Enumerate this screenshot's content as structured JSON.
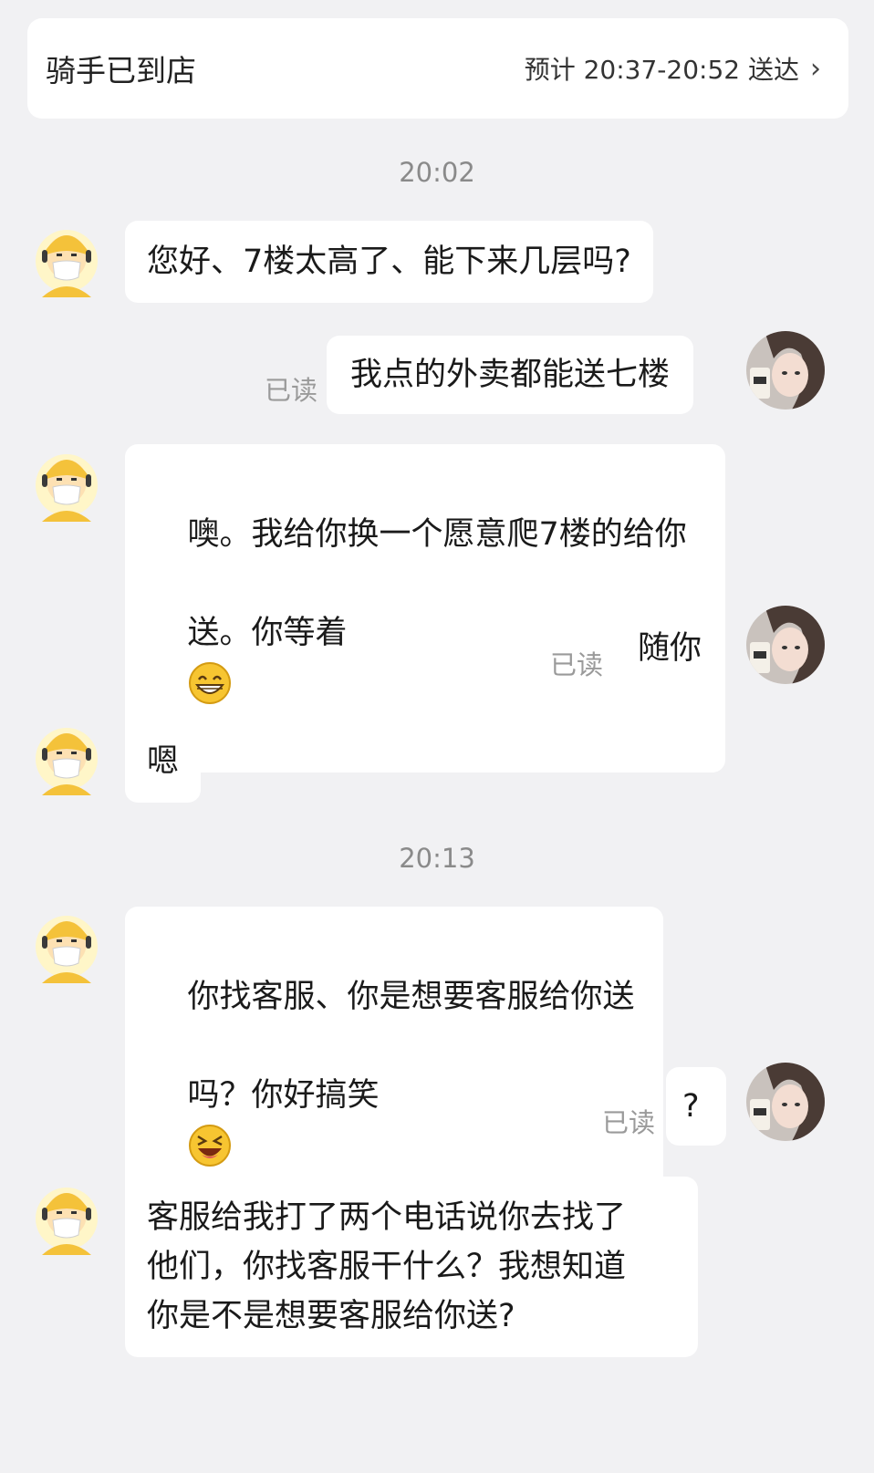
{
  "header": {
    "status": "骑手已到店",
    "eta": "预计 20:37-20:52 送达",
    "chevron": "›"
  },
  "chat": {
    "time_1": "20:02",
    "time_2": "20:13",
    "read_label": "已读",
    "messages": [
      {
        "from": "rider",
        "text": "您好、7楼太高了、能下来几层吗?"
      },
      {
        "from": "user",
        "text": "我点的外卖都能送七楼"
      },
      {
        "from": "rider",
        "text_line1": "噢。我给你换一个愿意爬7楼的给你",
        "text_line2": "送。你等着",
        "emoji": "grinning-emoji"
      },
      {
        "from": "user",
        "text": "随你"
      },
      {
        "from": "rider",
        "text": "嗯"
      },
      {
        "from": "rider",
        "text_line1": "你找客服、你是想要客服给你送",
        "text_line2": "吗？你好搞笑",
        "emoji": "laughing-emoji"
      },
      {
        "from": "user",
        "text": "?"
      },
      {
        "from": "rider",
        "text": "客服给我打了两个电话说你去找了\n他们，你找客服干什么？我想知道\n你是不是想要客服给你送?"
      }
    ]
  },
  "colors": {
    "background": "#f1f1f3",
    "bubble": "#ffffff",
    "rider_helmet": "#f5c842",
    "muted_text": "#8a8a8a"
  }
}
